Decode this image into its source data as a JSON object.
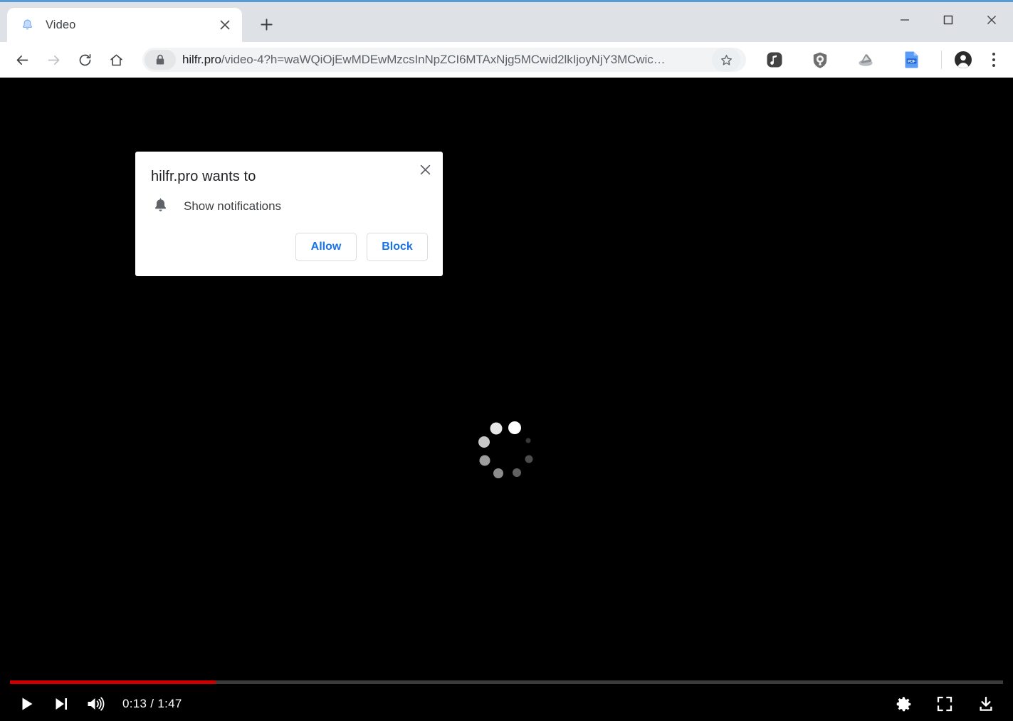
{
  "window": {
    "accent_color": "#5b9bd5",
    "controls": [
      {
        "name": "minimize",
        "glyph": "minimize-icon"
      },
      {
        "name": "maximize",
        "glyph": "maximize-icon"
      },
      {
        "name": "close",
        "glyph": "close-icon"
      }
    ]
  },
  "tabstrip": {
    "tabs": [
      {
        "title": "Video",
        "favicon": "bell-favicon",
        "close_label": "×"
      }
    ],
    "new_tab_label": "+"
  },
  "toolbar": {
    "back_icon": "back-arrow-icon",
    "forward_icon": "forward-arrow-icon",
    "reload_icon": "reload-icon",
    "home_icon": "home-icon",
    "lock_icon": "lock-icon",
    "url_host": "hilfr.pro",
    "url_path": "/video-4?h=waWQiOjEwMDEwMzcsInNpZCI6MTAxNjg5MCwid2lkIjoyNjY3MCwic…",
    "url_full": "hilfr.pro/video-4?h=waWQiOjEwMDEwMzcsInNpZCI6MTAxNjg5MCwid2lkIjoyNjY3MCwic…",
    "star_icon": "bookmark-star-icon",
    "extensions": [
      {
        "name": "music-extension-icon",
        "color": "#4a4a4a"
      },
      {
        "name": "shield-extension-icon",
        "color": "#6b6b6b"
      },
      {
        "name": "adblock-extension-icon",
        "color": "#9aa0a6"
      },
      {
        "name": "pdf-extension-icon",
        "color": "#4285f4",
        "label": "PDF"
      }
    ],
    "avatar_icon": "profile-avatar-icon",
    "menu_icon": "three-dot-menu-icon"
  },
  "permission_dialog": {
    "title": "hilfr.pro wants to",
    "close_label": "×",
    "permission_icon": "bell-icon",
    "permission_label": "Show notifications",
    "allow_label": "Allow",
    "block_label": "Block",
    "accent_color": "#1a73e8"
  },
  "video": {
    "background_color": "#000000",
    "spinner": {
      "name": "loading-spinner",
      "dots": [
        {
          "angle": -70,
          "radius": 34,
          "size": 18,
          "opacity": 1.0
        },
        {
          "angle": -25,
          "radius": 34,
          "size": 7,
          "opacity": 0.22
        },
        {
          "angle": 20,
          "radius": 34,
          "size": 11,
          "opacity": 0.3
        },
        {
          "angle": 65,
          "radius": 34,
          "size": 12,
          "opacity": 0.38
        },
        {
          "angle": 110,
          "radius": 34,
          "size": 14,
          "opacity": 0.55
        },
        {
          "angle": 155,
          "radius": 34,
          "size": 15,
          "opacity": 0.62
        },
        {
          "angle": 200,
          "radius": 34,
          "size": 16,
          "opacity": 0.78
        },
        {
          "angle": 245,
          "radius": 34,
          "size": 17,
          "opacity": 0.9
        }
      ]
    },
    "controls": {
      "play_icon": "play-icon",
      "next_icon": "next-track-icon",
      "volume_icon": "volume-on-icon",
      "settings_icon": "settings-gear-icon",
      "fullscreen_icon": "fullscreen-icon",
      "download_icon": "download-icon",
      "current_time": "0:13",
      "duration": "1:47",
      "time_display": "0:13 / 1:47",
      "progress_percent": 20.7,
      "progress_color": "#cc0000",
      "track_color": "#3a3a3a"
    }
  }
}
